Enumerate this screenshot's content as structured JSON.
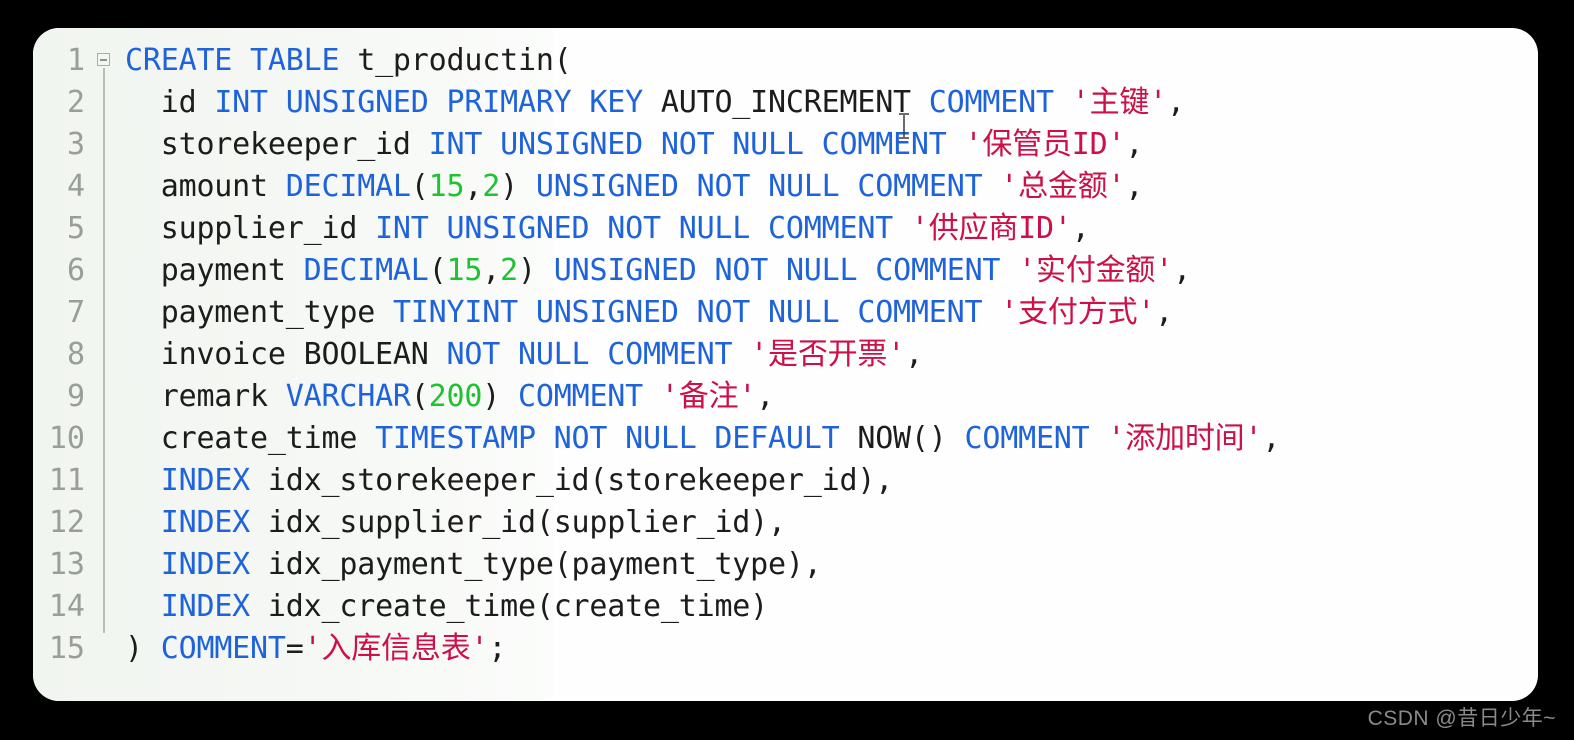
{
  "editor": {
    "language": "sql",
    "fold_marker": "collapse-box",
    "background_color": "#fdfefd",
    "gutter_color": "#f2f6f1",
    "line_number_color": "#9a9e9a",
    "theme_colors": {
      "keyword": "#1f63db",
      "number": "#1fc232",
      "string": "#cc1048",
      "plain": "#1c1c1c"
    },
    "line_numbers": [
      "1",
      "2",
      "3",
      "4",
      "5",
      "6",
      "7",
      "8",
      "9",
      "10",
      "11",
      "12",
      "13",
      "14",
      "15"
    ],
    "lines": [
      {
        "n": "1",
        "tokens": [
          {
            "t": "CREATE TABLE ",
            "c": "kw"
          },
          {
            "t": "t_productin(",
            "c": "pln"
          }
        ]
      },
      {
        "n": "2",
        "tokens": [
          {
            "t": "  id ",
            "c": "pln"
          },
          {
            "t": "INT UNSIGNED PRIMARY KEY ",
            "c": "kw"
          },
          {
            "t": "AUTO_INCREMENT ",
            "c": "pln"
          },
          {
            "t": "COMMENT ",
            "c": "kw"
          },
          {
            "t": "'主键'",
            "c": "str"
          },
          {
            "t": ",",
            "c": "pln"
          }
        ]
      },
      {
        "n": "3",
        "tokens": [
          {
            "t": "  storekeeper_id ",
            "c": "pln"
          },
          {
            "t": "INT UNSIGNED NOT NULL COMMENT ",
            "c": "kw"
          },
          {
            "t": "'保管员ID'",
            "c": "str"
          },
          {
            "t": ",",
            "c": "pln"
          }
        ]
      },
      {
        "n": "4",
        "tokens": [
          {
            "t": "  amount ",
            "c": "pln"
          },
          {
            "t": "DECIMAL",
            "c": "kw"
          },
          {
            "t": "(",
            "c": "pln"
          },
          {
            "t": "15",
            "c": "num"
          },
          {
            "t": ",",
            "c": "pln"
          },
          {
            "t": "2",
            "c": "num"
          },
          {
            "t": ") ",
            "c": "pln"
          },
          {
            "t": "UNSIGNED NOT NULL COMMENT ",
            "c": "kw"
          },
          {
            "t": "'总金额'",
            "c": "str"
          },
          {
            "t": ",",
            "c": "pln"
          }
        ]
      },
      {
        "n": "5",
        "tokens": [
          {
            "t": "  supplier_id ",
            "c": "pln"
          },
          {
            "t": "INT UNSIGNED NOT NULL COMMENT ",
            "c": "kw"
          },
          {
            "t": "'供应商ID'",
            "c": "str"
          },
          {
            "t": ",",
            "c": "pln"
          }
        ]
      },
      {
        "n": "6",
        "tokens": [
          {
            "t": "  payment ",
            "c": "pln"
          },
          {
            "t": "DECIMAL",
            "c": "kw"
          },
          {
            "t": "(",
            "c": "pln"
          },
          {
            "t": "15",
            "c": "num"
          },
          {
            "t": ",",
            "c": "pln"
          },
          {
            "t": "2",
            "c": "num"
          },
          {
            "t": ") ",
            "c": "pln"
          },
          {
            "t": "UNSIGNED NOT NULL COMMENT ",
            "c": "kw"
          },
          {
            "t": "'实付金额'",
            "c": "str"
          },
          {
            "t": ",",
            "c": "pln"
          }
        ]
      },
      {
        "n": "7",
        "tokens": [
          {
            "t": "  payment_type ",
            "c": "pln"
          },
          {
            "t": "TINYINT UNSIGNED NOT NULL COMMENT ",
            "c": "kw"
          },
          {
            "t": "'支付方式'",
            "c": "str"
          },
          {
            "t": ",",
            "c": "pln"
          }
        ]
      },
      {
        "n": "8",
        "tokens": [
          {
            "t": "  invoice BOOLEAN ",
            "c": "pln"
          },
          {
            "t": "NOT NULL COMMENT ",
            "c": "kw"
          },
          {
            "t": "'是否开票'",
            "c": "str"
          },
          {
            "t": ",",
            "c": "pln"
          }
        ]
      },
      {
        "n": "9",
        "tokens": [
          {
            "t": "  remark ",
            "c": "pln"
          },
          {
            "t": "VARCHAR",
            "c": "kw"
          },
          {
            "t": "(",
            "c": "pln"
          },
          {
            "t": "200",
            "c": "num"
          },
          {
            "t": ") ",
            "c": "pln"
          },
          {
            "t": "COMMENT ",
            "c": "kw"
          },
          {
            "t": "'备注'",
            "c": "str"
          },
          {
            "t": ",",
            "c": "pln"
          }
        ]
      },
      {
        "n": "10",
        "tokens": [
          {
            "t": "  create_time ",
            "c": "pln"
          },
          {
            "t": "TIMESTAMP NOT NULL DEFAULT ",
            "c": "kw"
          },
          {
            "t": "NOW() ",
            "c": "pln"
          },
          {
            "t": "COMMENT ",
            "c": "kw"
          },
          {
            "t": "'添加时间'",
            "c": "str"
          },
          {
            "t": ",",
            "c": "pln"
          }
        ]
      },
      {
        "n": "11",
        "tokens": [
          {
            "t": "  ",
            "c": "pln"
          },
          {
            "t": "INDEX ",
            "c": "kw"
          },
          {
            "t": "idx_storekeeper_id(storekeeper_id),",
            "c": "pln"
          }
        ]
      },
      {
        "n": "12",
        "tokens": [
          {
            "t": "  ",
            "c": "pln"
          },
          {
            "t": "INDEX ",
            "c": "kw"
          },
          {
            "t": "idx_supplier_id(supplier_id),",
            "c": "pln"
          }
        ]
      },
      {
        "n": "13",
        "tokens": [
          {
            "t": "  ",
            "c": "pln"
          },
          {
            "t": "INDEX ",
            "c": "kw"
          },
          {
            "t": "idx_payment_type(payment_type),",
            "c": "pln"
          }
        ]
      },
      {
        "n": "14",
        "tokens": [
          {
            "t": "  ",
            "c": "pln"
          },
          {
            "t": "INDEX ",
            "c": "kw"
          },
          {
            "t": "idx_create_time(create_time)",
            "c": "pln"
          }
        ]
      },
      {
        "n": "15",
        "tokens": [
          {
            "t": ") ",
            "c": "pln"
          },
          {
            "t": "COMMENT",
            "c": "kw"
          },
          {
            "t": "=",
            "c": "pln"
          },
          {
            "t": "'入库信息表'",
            "c": "str"
          },
          {
            "t": ";",
            "c": "pln"
          }
        ]
      }
    ]
  },
  "watermark": {
    "text": "CSDN @昔日少年~"
  }
}
